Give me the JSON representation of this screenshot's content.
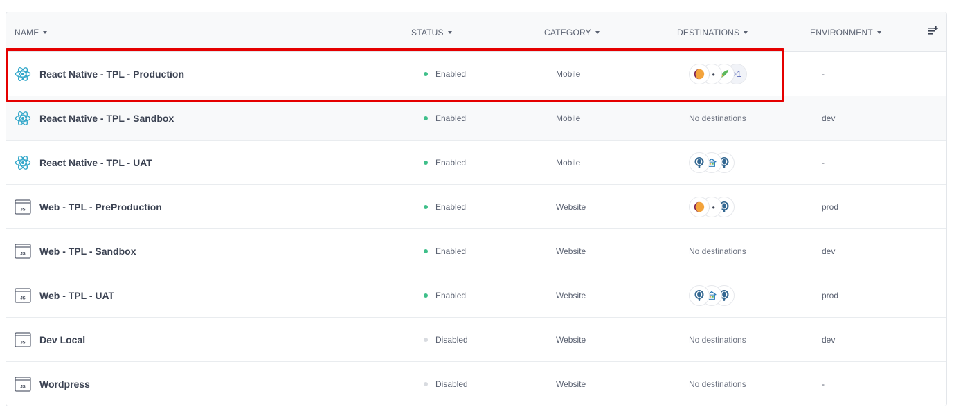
{
  "headers": {
    "name": "NAME",
    "status": "STATUS",
    "category": "CATEGORY",
    "destinations": "DESTINATIONS",
    "environment": "ENVIRONMENT"
  },
  "colors": {
    "enabled_dot": "#3fbf8a",
    "disabled_dot": "#d8dbe0",
    "highlight": "#e50000"
  },
  "rows": [
    {
      "icon": "react-icon",
      "name": "React Native - TPL - Production",
      "status": "Enabled",
      "category": "Mobile",
      "destinations": [
        "mixpanel-icon",
        "dots-icon",
        "leaf-icon"
      ],
      "more": "+1",
      "no_dest": "",
      "environment": "-"
    },
    {
      "icon": "react-icon",
      "name": "React Native - TPL - Sandbox",
      "status": "Enabled",
      "category": "Mobile",
      "destinations": [],
      "more": "",
      "no_dest": "No destinations",
      "environment": "dev"
    },
    {
      "icon": "react-icon",
      "name": "React Native - TPL - UAT",
      "status": "Enabled",
      "category": "Mobile",
      "destinations": [
        "postgres-icon",
        "warehouse-icon",
        "postgres-icon"
      ],
      "more": "",
      "no_dest": "",
      "environment": "-"
    },
    {
      "icon": "js-icon",
      "name": "Web - TPL - PreProduction",
      "status": "Enabled",
      "category": "Website",
      "destinations": [
        "mixpanel-icon",
        "dots-icon",
        "postgres-icon"
      ],
      "more": "",
      "no_dest": "",
      "environment": "prod"
    },
    {
      "icon": "js-icon",
      "name": "Web - TPL - Sandbox",
      "status": "Enabled",
      "category": "Website",
      "destinations": [],
      "more": "",
      "no_dest": "No destinations",
      "environment": "dev"
    },
    {
      "icon": "js-icon",
      "name": "Web - TPL - UAT",
      "status": "Enabled",
      "category": "Website",
      "destinations": [
        "postgres-icon",
        "warehouse-icon",
        "postgres-icon"
      ],
      "more": "",
      "no_dest": "",
      "environment": "prod"
    },
    {
      "icon": "js-icon",
      "name": "Dev Local",
      "status": "Disabled",
      "category": "Website",
      "destinations": [],
      "more": "",
      "no_dest": "No destinations",
      "environment": "dev"
    },
    {
      "icon": "js-icon",
      "name": "Wordpress",
      "status": "Disabled",
      "category": "Website",
      "destinations": [],
      "more": "",
      "no_dest": "No destinations",
      "environment": "-"
    }
  ]
}
